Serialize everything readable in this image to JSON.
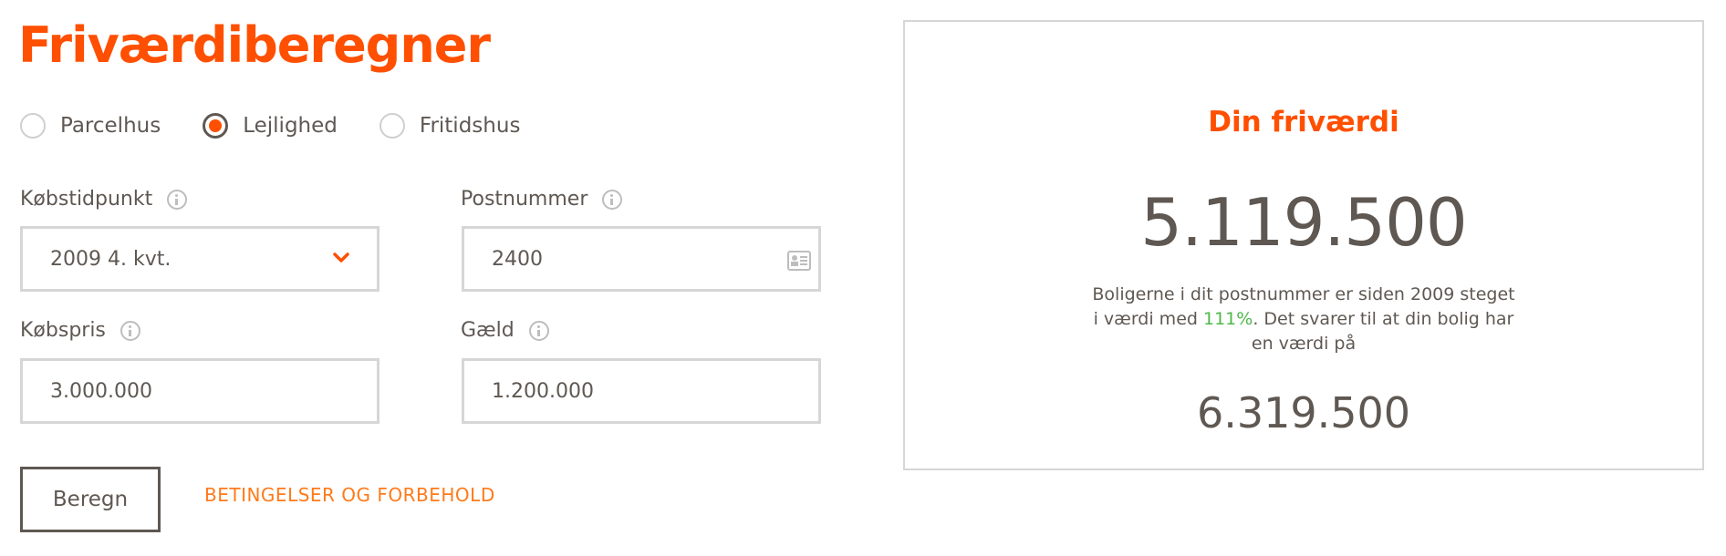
{
  "header": {
    "title": "Friværdiberegner"
  },
  "property_type": {
    "options": [
      "Parcelhus",
      "Lejlighed",
      "Fritidshus"
    ],
    "selected": "Lejlighed"
  },
  "form": {
    "purchase_time": {
      "label": "Købstidpunkt",
      "value": "2009 4. kvt."
    },
    "postal_code": {
      "label": "Postnummer",
      "value": "2400"
    },
    "purchase_price": {
      "label": "Købspris",
      "value": "3.000.000"
    },
    "debt": {
      "label": "Gæld",
      "value": "1.200.000"
    },
    "calculate_label": "Beregn",
    "terms_link": "BETINGELSER OG FORBEHOLD"
  },
  "result": {
    "title": "Din friværdi",
    "equity_value": "5.119.500",
    "desc_part1": "Boligerne i dit postnummer er siden 2009 steget i værdi med ",
    "desc_pct": "111%",
    "desc_part2": ". Det svarer til at din bolig har en værdi på",
    "home_value": "6.319.500"
  },
  "colors": {
    "accent": "#ff4f00",
    "link": "#ff7a1a",
    "text": "#5f5852",
    "border": "#d6d6d6",
    "positive": "#4cb848"
  },
  "icons": {
    "dropdown": "chevron-down-icon",
    "info": "info-icon",
    "postal": "address-card-icon"
  }
}
